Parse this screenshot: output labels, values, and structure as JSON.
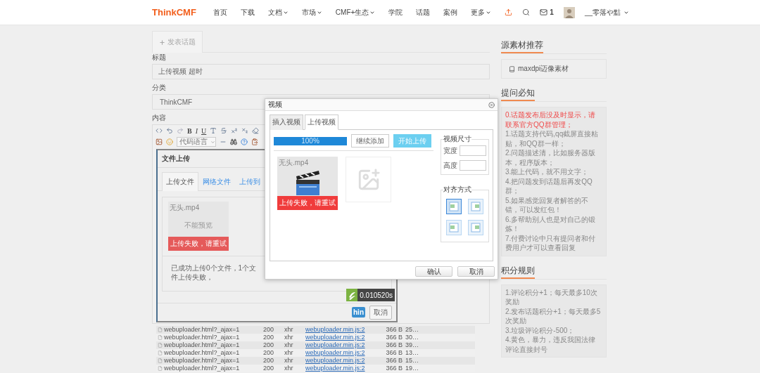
{
  "navbar": {
    "logo": "ThinkCMF",
    "items": [
      {
        "label": "首页",
        "kind": "link"
      },
      {
        "label": "下载",
        "kind": "link"
      },
      {
        "label": "文档",
        "kind": "dropdown"
      },
      {
        "label": "市场",
        "kind": "dropdown"
      },
      {
        "label": "CMF+生态",
        "kind": "dropdown"
      },
      {
        "label": "学院",
        "kind": "link"
      },
      {
        "label": "话题",
        "kind": "link"
      },
      {
        "label": "案例",
        "kind": "link"
      },
      {
        "label": "更多",
        "kind": "dropdown"
      }
    ],
    "mail_count": "1",
    "username": "__零落や黠"
  },
  "compose_tab": {
    "label": "发表话题",
    "selected": true
  },
  "form": {
    "title_label": "标题",
    "title_value": "上传视频 超时",
    "category_label": "分类",
    "category_value": "ThinkCMF",
    "content_label": "内容"
  },
  "toolbar": {
    "letters": [
      "B",
      "I",
      "U"
    ],
    "code_language": "代码语言"
  },
  "file_dialog": {
    "title": "文件上传",
    "tabs": [
      {
        "label": "上传文件",
        "selected": true
      },
      {
        "label": "网络文件",
        "selected": false
      },
      {
        "label": "上传到",
        "selected": false
      }
    ],
    "file": {
      "name": "无头.mp4",
      "preview": "不能预览",
      "error": "上传失败，请重试"
    },
    "status": "已成功上传0个文件，1个文件上传失败，",
    "partial_logo": "hin",
    "cancel": "取消"
  },
  "trace": {
    "time": "0.010520s"
  },
  "network_rows": [
    {
      "name": "webuploader.html?_ajax=1",
      "status": "200",
      "type": "xhr",
      "initiator": "webuploader.min.js:2",
      "size": "366 B",
      "time": "25…"
    },
    {
      "name": "webuploader.html?_ajax=1",
      "status": "200",
      "type": "xhr",
      "initiator": "webuploader.min.js:2",
      "size": "366 B",
      "time": "30…"
    },
    {
      "name": "webuploader.html?_ajax=1",
      "status": "200",
      "type": "xhr",
      "initiator": "webuploader.min.js:2",
      "size": "366 B",
      "time": "39…"
    },
    {
      "name": "webuploader.html?_ajax=1",
      "status": "200",
      "type": "xhr",
      "initiator": "webuploader.min.js:2",
      "size": "366 B",
      "time": "13…"
    },
    {
      "name": "webuploader.html?_ajax=1",
      "status": "200",
      "type": "xhr",
      "initiator": "webuploader.min.js:2",
      "size": "366 B",
      "time": "15…"
    },
    {
      "name": "webuploader.html?_ajax=1",
      "status": "200",
      "type": "xhr",
      "initiator": "webuploader.min.js:2",
      "size": "366 B",
      "time": "19…"
    }
  ],
  "video_dialog": {
    "title": "视频",
    "tabs": [
      {
        "label": "插入视频",
        "selected": false
      },
      {
        "label": "上传视频",
        "selected": true
      }
    ],
    "progress": {
      "level": 1,
      "label": "100%"
    },
    "add_button": "继续添加",
    "start_button": "开始上传",
    "file": {
      "name": "无头.mp4",
      "error": "上传失败，请重试"
    },
    "size_legend": "视频尺寸",
    "width_label": "宽度",
    "height_label": "高度",
    "align_legend": "对齐方式",
    "align_options": [
      {
        "selected": true
      },
      {
        "selected": false
      },
      {
        "selected": false
      },
      {
        "selected": false
      }
    ],
    "confirm": "确认",
    "cancel": "取消"
  },
  "sidebar": {
    "sections": [
      {
        "title": "源素材推荐",
        "kind": "links",
        "items": [
          {
            "text": "maxdpi迈像素材"
          }
        ]
      },
      {
        "title": "提问必知",
        "kind": "notes",
        "items": [
          {
            "text": "0.话题发布后没及时显示，请联系官方QQ群管理；",
            "highlight": true
          },
          {
            "text": "1.话题支持代码,qq截屏直接粘贴，和QQ群一样；",
            "highlight": false
          },
          {
            "text": "2.问题描述清，比如服务器版本，程序版本；",
            "highlight": false
          },
          {
            "text": "3.能上代码，就不用文字；",
            "highlight": false
          },
          {
            "text": "4.把问题发到话题后再发QQ群；",
            "highlight": false
          },
          {
            "text": "5.如果感觉回复者解答的不错，可以发红包！",
            "highlight": false
          },
          {
            "text": "6.多帮助别人也是对自己的锻炼！",
            "highlight": false
          },
          {
            "text": "7.付费讨论中只有提问者和付费用户才可以查看回复",
            "highlight": false
          }
        ]
      },
      {
        "title": "积分规则",
        "kind": "notes",
        "items": [
          {
            "text": "1.评论积分+1；每天最多10次奖励",
            "highlight": false
          },
          {
            "text": "2.发布话题积分+1；每天最多5次奖励",
            "highlight": false
          },
          {
            "text": "3.垃圾评论积分-500；",
            "highlight": false
          },
          {
            "text": "4.黄色，暴力，违反我国法律评论直接封号",
            "highlight": false
          }
        ]
      }
    ]
  }
}
